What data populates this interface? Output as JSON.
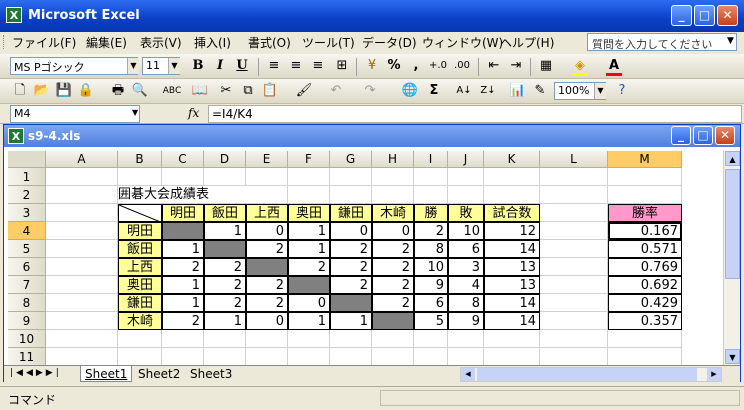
{
  "app": {
    "title": "Microsoft Excel"
  },
  "menu": [
    "ファイル(F)",
    "編集(E)",
    "表示(V)",
    "挿入(I)",
    "書式(O)",
    "ツール(T)",
    "データ(D)",
    "ウィンドウ(W)",
    "ヘルプ(H)"
  ],
  "help_search": {
    "placeholder": "質問を入力してください"
  },
  "format_toolbar": {
    "font": "MS Pゴシック",
    "size": "11",
    "bold": "B",
    "italic": "I",
    "underline": "U",
    "percent": "%",
    "comma": ","
  },
  "standard_toolbar": {
    "zoom": "100%"
  },
  "formula_bar": {
    "cell_ref": "M4",
    "fx": "fx",
    "formula": "=I4/K4"
  },
  "workbook": {
    "title": "s9-4.xls"
  },
  "columns": [
    "A",
    "B",
    "C",
    "D",
    "E",
    "F",
    "G",
    "H",
    "I",
    "J",
    "K",
    "L",
    "M"
  ],
  "rows": [
    "1",
    "2",
    "3",
    "4",
    "5",
    "6",
    "7",
    "8",
    "9",
    "10",
    "11"
  ],
  "table": {
    "title": "囲碁大会成績表",
    "headers": [
      "明田",
      "飯田",
      "上西",
      "奥田",
      "鎌田",
      "木崎",
      "勝",
      "敗",
      "試合数"
    ],
    "rows": [
      {
        "name": "明田",
        "cells": [
          "",
          "1",
          "0",
          "1",
          "0",
          "0",
          "2",
          "10",
          "12"
        ],
        "rate": "0.167"
      },
      {
        "name": "飯田",
        "cells": [
          "1",
          "",
          "2",
          "1",
          "2",
          "2",
          "8",
          "6",
          "14"
        ],
        "rate": "0.571"
      },
      {
        "name": "上西",
        "cells": [
          "2",
          "2",
          "",
          "2",
          "2",
          "2",
          "10",
          "3",
          "13"
        ],
        "rate": "0.769"
      },
      {
        "name": "奥田",
        "cells": [
          "1",
          "2",
          "2",
          "",
          "2",
          "2",
          "9",
          "4",
          "13"
        ],
        "rate": "0.692"
      },
      {
        "name": "鎌田",
        "cells": [
          "1",
          "2",
          "2",
          "0",
          "",
          "2",
          "6",
          "8",
          "14"
        ],
        "rate": "0.429"
      },
      {
        "name": "木崎",
        "cells": [
          "2",
          "1",
          "0",
          "1",
          "1",
          "",
          "5",
          "9",
          "14"
        ],
        "rate": "0.357"
      }
    ],
    "rate_header": "勝率"
  },
  "sheets": [
    "Sheet1",
    "Sheet2",
    "Sheet3"
  ],
  "status": {
    "mode": "コマンド"
  },
  "colors": {
    "title_blue": "#0a3fc4",
    "header_yellow": "#ffff99",
    "rate_pink": "#ff99cc",
    "diag_gray": "#808080",
    "active_col": "#ffcc66"
  }
}
